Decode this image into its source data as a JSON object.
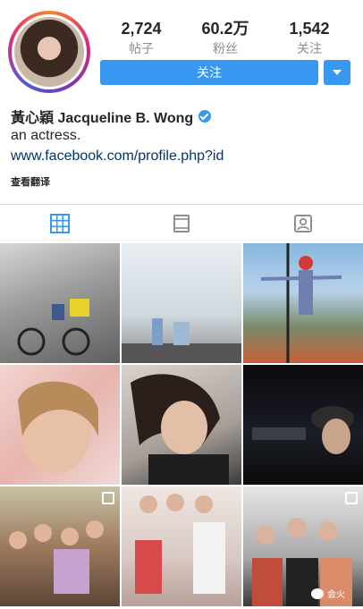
{
  "profile": {
    "stats": [
      {
        "value": "2,724",
        "label": "帖子"
      },
      {
        "value": "60.2万",
        "label": "粉丝"
      },
      {
        "value": "1,542",
        "label": "关注"
      }
    ],
    "follow_label": "关注",
    "name": "黃心穎 Jacqueline B. Wong",
    "bio": "an actress.",
    "link": "www.facebook.com/profile.php?id",
    "translate_label": "查看翻译"
  },
  "colors": {
    "accent": "#3897f0"
  },
  "icons": {
    "grid": "grid-icon",
    "feed": "feed-icon",
    "tagged": "tagged-icon",
    "verified": "verified-icon"
  },
  "watermark": "会火"
}
